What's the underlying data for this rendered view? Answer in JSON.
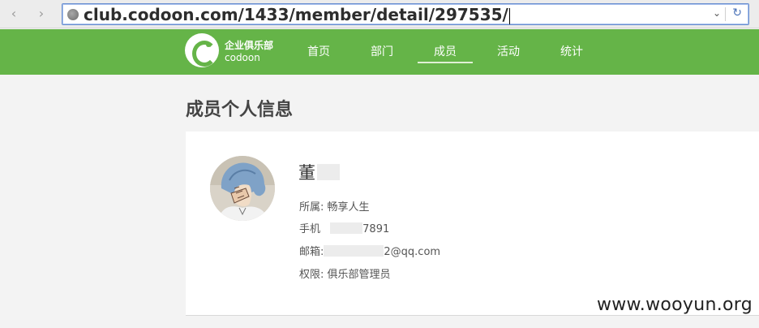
{
  "browser": {
    "url": "club.codoon.com/1433/member/detail/297535/",
    "back_icon": "‹",
    "forward_icon": "›",
    "dropdown_icon": "⌄",
    "reload_icon": "↻"
  },
  "header": {
    "logo_cn": "企业俱乐部",
    "logo_en": "codoon",
    "nav": [
      {
        "label": "首页"
      },
      {
        "label": "部门"
      },
      {
        "label": "成员",
        "active": true
      },
      {
        "label": "活动"
      },
      {
        "label": "统计"
      }
    ]
  },
  "page": {
    "title": "成员个人信息"
  },
  "member": {
    "name": "董",
    "affiliation_label": "所属:",
    "affiliation_value": "畅享人生",
    "phone_label": "手机",
    "phone_suffix": "7891",
    "email_label": "邮箱:",
    "email_suffix": "2@qq.com",
    "role_label": "权限:",
    "role_value": "俱乐部管理员"
  },
  "watermark": "www.wooyun.org",
  "colors": {
    "header_green": "#65b448",
    "page_bg": "#f3f3f3"
  }
}
